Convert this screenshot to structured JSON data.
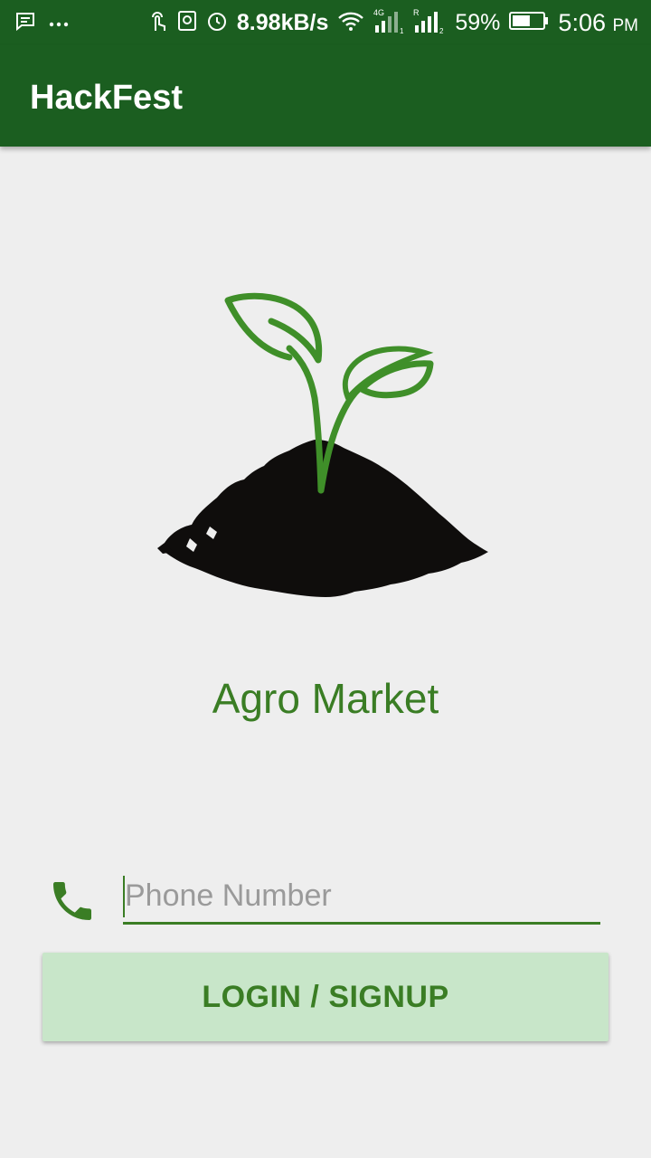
{
  "status_bar": {
    "network_speed": "8.98kB/s",
    "battery_percent": "59%",
    "time": "5:06",
    "time_suffix": "PM",
    "battery_level": 0.59,
    "icons": [
      "message-icon",
      "more-icon",
      "touch-icon",
      "sd-icon",
      "alarm-icon",
      "wifi-icon",
      "signal-4g-icon",
      "signal-r-icon",
      "battery-icon"
    ]
  },
  "app_bar": {
    "title": "HackFest"
  },
  "main": {
    "logo": "seedling-soil-logo",
    "app_name": "Agro Market"
  },
  "login": {
    "phone_icon": "phone-icon",
    "phone_placeholder": "Phone Number",
    "phone_value": "",
    "button_label": "LOGIN / SIGNUP"
  },
  "colors": {
    "primary_dark": "#1b5e20",
    "accent_green": "#3a7d24",
    "button_bg": "#c8e6c9",
    "background": "#eeeeee"
  }
}
